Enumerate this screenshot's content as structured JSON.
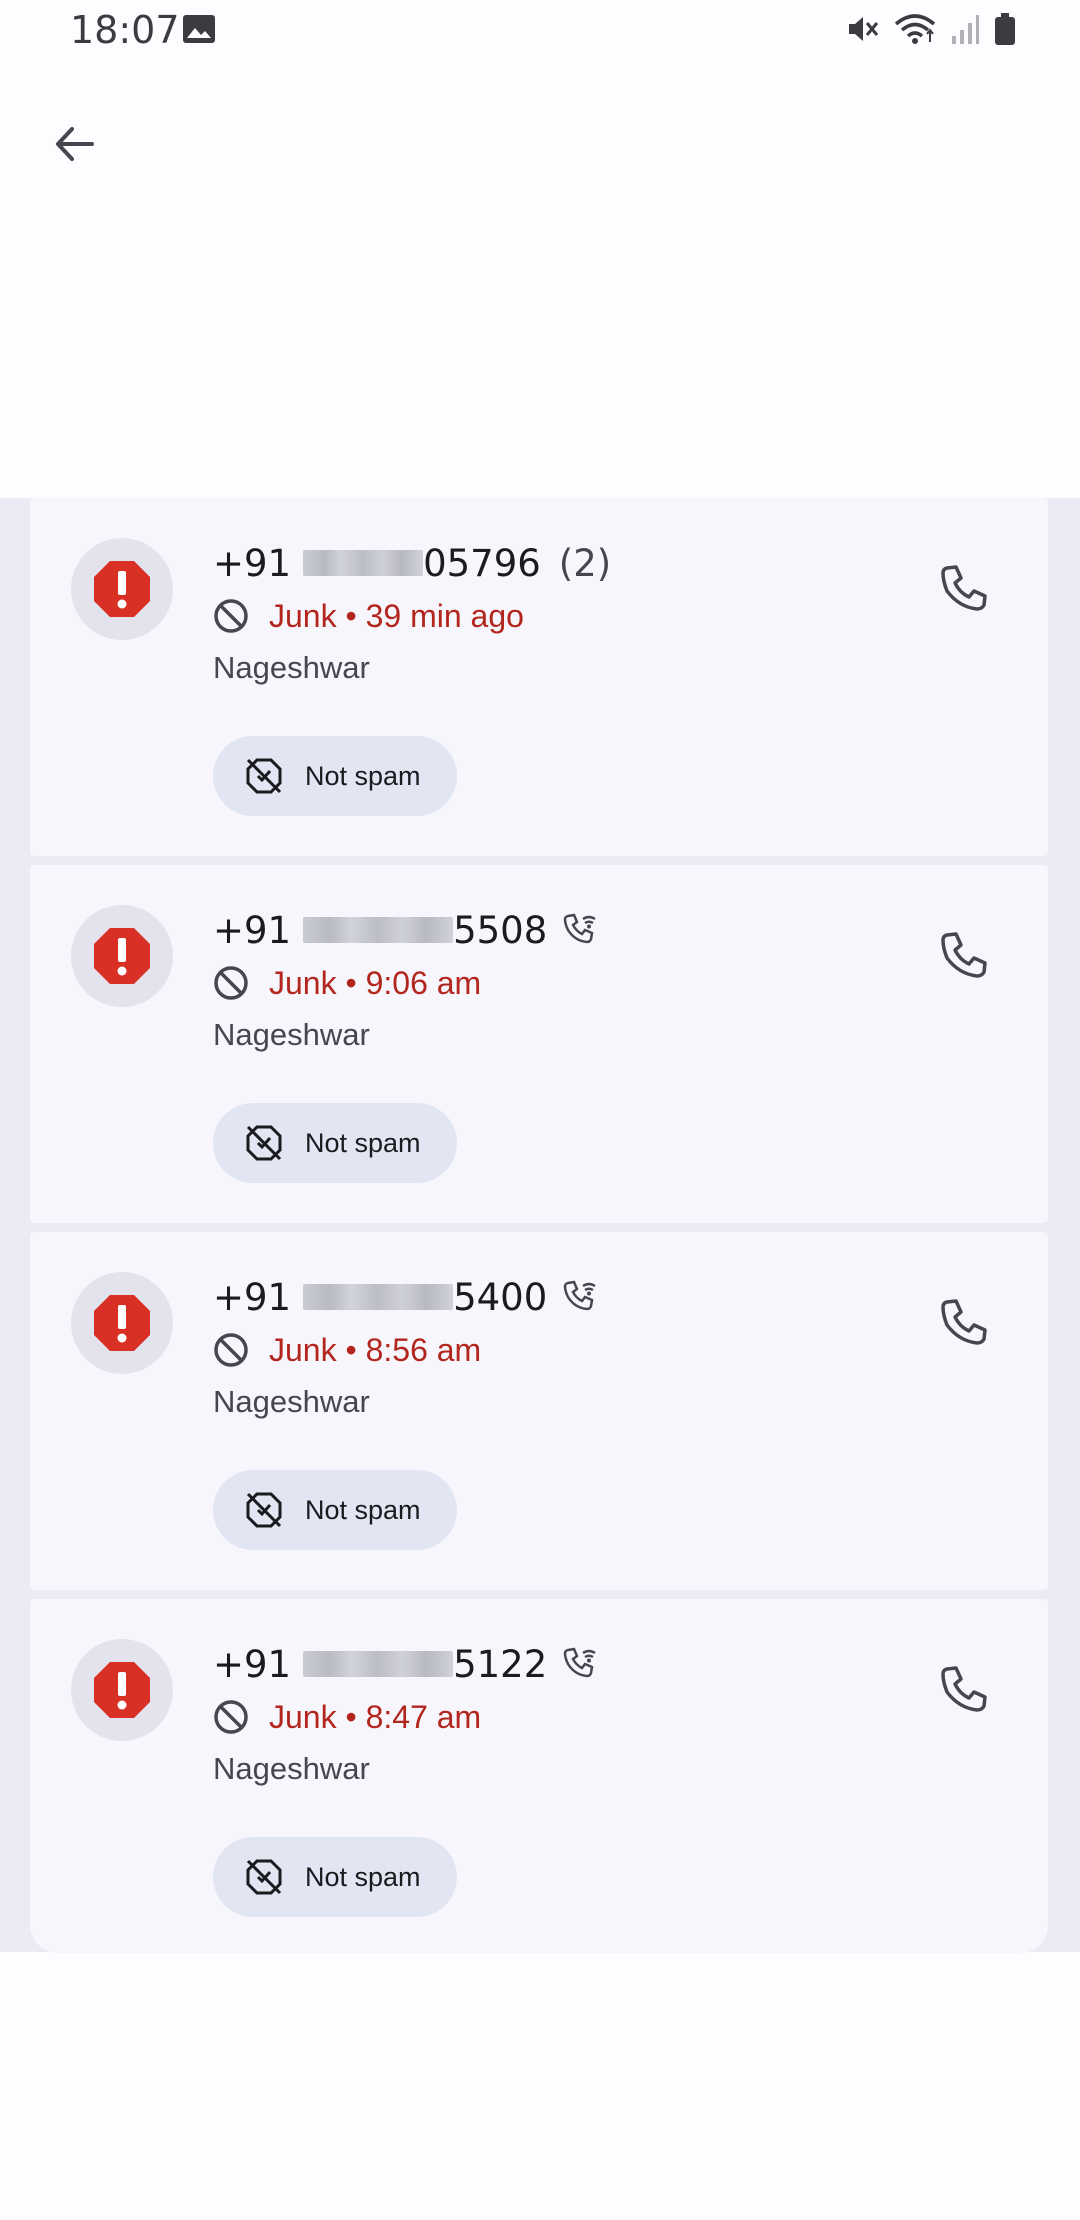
{
  "status_bar": {
    "time": "18:07",
    "icons": [
      "image-icon",
      "mute-icon",
      "wifi-icon",
      "signal-icon",
      "battery-icon"
    ]
  },
  "header": {
    "back_icon": "arrow-left-icon"
  },
  "colors": {
    "junk": "#b3261e",
    "alert": "#d93025",
    "card_bg": "#f6f6fc",
    "list_bg": "#eaebf5",
    "chip_bg": "#e2e5f2"
  },
  "calls": [
    {
      "prefix": "+91",
      "suffix": "05796",
      "count": "(2)",
      "wifi_call": false,
      "junk": "Junk",
      "separator": "•",
      "time": "39 min ago",
      "location": "Nageshwar",
      "not_spam": "Not spam"
    },
    {
      "prefix": "+91",
      "suffix": "5508",
      "count": "",
      "wifi_call": true,
      "junk": "Junk",
      "separator": "•",
      "time": "9:06 am",
      "location": "Nageshwar",
      "not_spam": "Not spam"
    },
    {
      "prefix": "+91",
      "suffix": "5400",
      "count": "",
      "wifi_call": true,
      "junk": "Junk",
      "separator": "•",
      "time": "8:56 am",
      "location": "Nageshwar",
      "not_spam": "Not spam"
    },
    {
      "prefix": "+91",
      "suffix": "5122",
      "count": "",
      "wifi_call": true,
      "junk": "Junk",
      "separator": "•",
      "time": "8:47 am",
      "location": "Nageshwar",
      "not_spam": "Not spam"
    }
  ]
}
